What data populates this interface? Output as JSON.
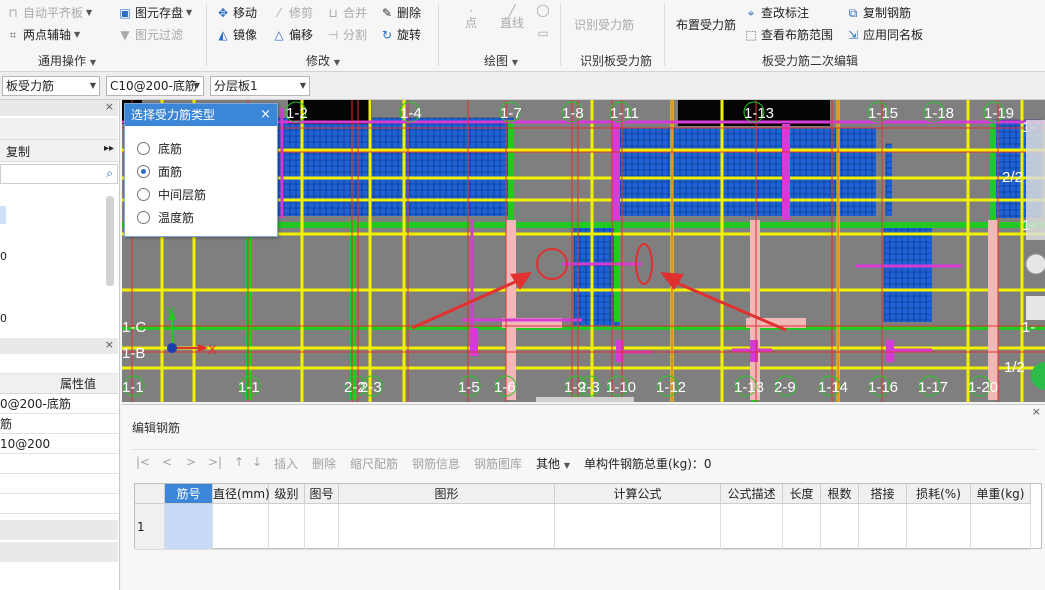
{
  "ribbon": {
    "common_ops": {
      "auto_align_slab": "自动平齐板",
      "two_point_axis": "两点辅轴",
      "save_element": "图元存盘",
      "element_filter": "图元过滤",
      "group_label": "通用操作"
    },
    "modify": {
      "move": "移动",
      "trim": "修剪",
      "merge": "合并",
      "delete": "删除",
      "mirror": "镜像",
      "offset": "偏移",
      "split": "分割",
      "rotate": "旋转",
      "group_label": "修改"
    },
    "draw": {
      "point": "点",
      "line": "直线",
      "group_label": "绘图"
    },
    "recognize": {
      "recognize_rebar": "识别受力筋",
      "group_label": "识别板受力筋"
    },
    "secondary_edit": {
      "place_rebar": "布置受力筋",
      "check_mark": "查改标注",
      "view_range": "查看布筋范围",
      "copy_rebar": "复制钢筋",
      "apply_same_slab": "应用同名板",
      "group_label": "板受力筋二次编辑"
    }
  },
  "selectors": {
    "element_type": "板受力筋",
    "rebar_name": "C10@200-底筋",
    "layer": "分层板1"
  },
  "left_panel": {
    "copy_label": "复制",
    "property_header": "属性值",
    "property_values": [
      "0@200-底筋",
      "筋",
      "10@200"
    ],
    "left_markers": [
      "0",
      "0"
    ]
  },
  "dialog": {
    "title": "选择受力筋类型",
    "options": [
      "底筋",
      "面筋",
      "中间层筋",
      "温度筋"
    ],
    "selected": "面筋"
  },
  "canvas": {
    "top_axes": [
      "1-2",
      "1-4",
      "1-7",
      "1-8",
      "1-11",
      "1-13",
      "1-15",
      "1-18",
      "1-19"
    ],
    "bottom_axes": [
      "1-1",
      "1-1",
      "2-2",
      "2-3",
      "1-5",
      "1-6",
      "1-9",
      "2-3",
      "1-10",
      "1-12",
      "1-13",
      "2-9",
      "1-14",
      "1-16",
      "1-17",
      "1-20"
    ],
    "left_axes": [
      "1-C",
      "1-B"
    ],
    "right_axes": [
      "1-",
      "2/2",
      "1-",
      "1-",
      "1/2"
    ],
    "axis_x_label": "X",
    "axis_y_label": "Y",
    "colors": {
      "background": "#7f7f7f",
      "blue_mesh": "#1e63d6",
      "yellow": "#f2f200",
      "green": "#22c922",
      "magenta": "#d63bd6",
      "red": "#e03030",
      "pink": "#f2b8b8"
    }
  },
  "edit_panel": {
    "title": "编辑钢筋",
    "toolbar": {
      "first": "|<",
      "prev": "<",
      "next": ">",
      "last": ">|",
      "up": "↑",
      "down": "↓",
      "insert": "插入",
      "delete": "删除",
      "scale_rebar": "缩尺配筋",
      "rebar_info": "钢筋信息",
      "rebar_library": "钢筋图库",
      "other": "其他",
      "total_weight": "单构件钢筋总重(kg)：0"
    },
    "columns": [
      "筋号",
      "直径(mm)",
      "级别",
      "图号",
      "图形",
      "计算公式",
      "公式描述",
      "长度",
      "根数",
      "搭接",
      "损耗(%)",
      "单重(kg)"
    ],
    "row_number": "1"
  }
}
